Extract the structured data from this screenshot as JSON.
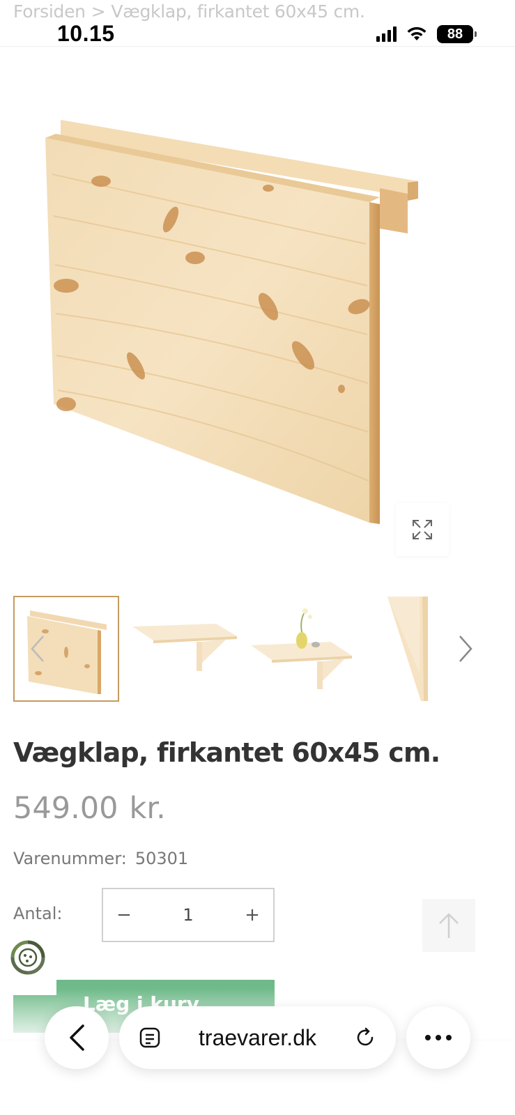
{
  "status_bar": {
    "time": "10.15",
    "battery": "88"
  },
  "breadcrumb": {
    "home": "Forsiden",
    "separator": ">",
    "current": "Vægklap, firkantet 60x45 cm."
  },
  "product": {
    "title": "Vægklap, firkantet 60x45 cm.",
    "price": "549.00",
    "currency": "kr.",
    "sku_label": "Varenummer:",
    "sku_value": "50301",
    "quantity_label": "Antal:",
    "quantity_value": "1",
    "quantity_minus": "−",
    "quantity_plus": "+",
    "add_to_cart_label": "Læg i kurv"
  },
  "gallery": {
    "thumbnail_count": 4,
    "selected_index": 0
  },
  "browser": {
    "url": "traevarer.dk"
  },
  "colors": {
    "accent_green": "#6db988",
    "thumb_selected_border": "#c69a60",
    "price_grey": "#999999"
  },
  "icons": [
    "expand-icon",
    "chevron-left-icon",
    "chevron-right-icon",
    "arrow-up-icon",
    "back-icon",
    "tabs-icon",
    "reload-icon",
    "more-icon",
    "cookie-widget-icon"
  ]
}
